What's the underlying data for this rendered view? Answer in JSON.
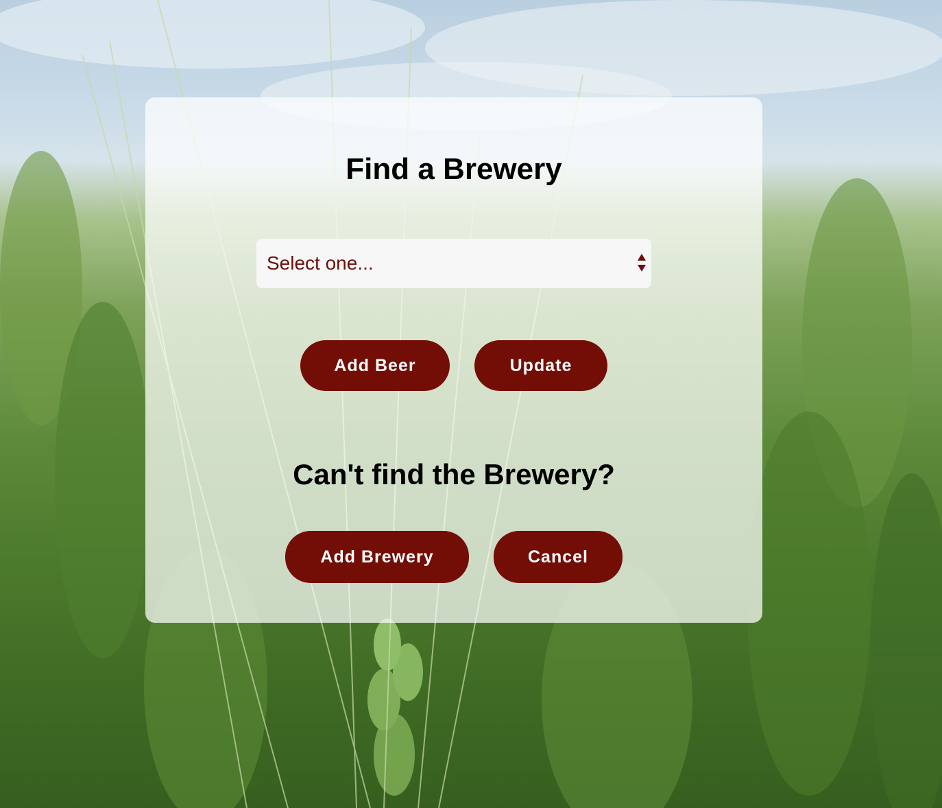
{
  "page": {
    "background_image": "wheat-field",
    "accent_color": "#730e06"
  },
  "finder": {
    "title": "Find a Brewery",
    "select": {
      "selected_value": "Select one..."
    },
    "add_beer_label": "Add Beer",
    "update_label": "Update"
  },
  "missing": {
    "heading": "Can't find the Brewery?",
    "add_brewery_label": "Add Brewery",
    "cancel_label": "Cancel"
  }
}
